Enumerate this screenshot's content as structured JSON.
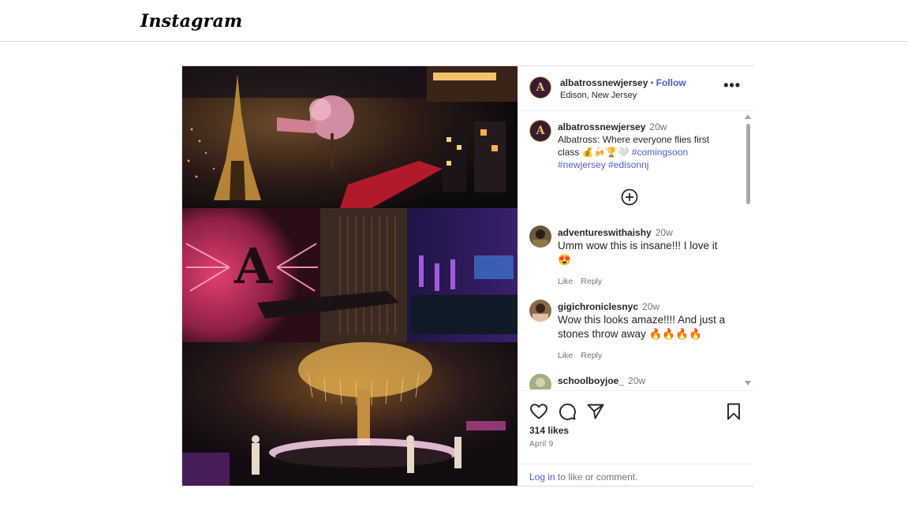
{
  "app": {
    "logo": "Instagram"
  },
  "post": {
    "author": "albatrossnewjersey",
    "follow_label": "Follow",
    "dot": "•",
    "location": "Edison, New Jersey",
    "avatar_letter": "A",
    "more_label": "•••",
    "caption": {
      "username": "albatrossnewjersey",
      "time": "20w",
      "text": "Albatross: Where everyone flies first class 💰🍻🏆🤍",
      "hashtags": [
        "#comingsoon",
        "#newjersey",
        "#edisonnj"
      ]
    },
    "comments": [
      {
        "username": "adventureswithaishy",
        "time": "20w",
        "text": "Umm wow this is insane!!! I love it 😍",
        "like": "Like",
        "reply": "Reply"
      },
      {
        "username": "gigichroniclesnyc",
        "time": "20w",
        "text": "Wow this looks amaze!!!! And just a stones throw away 🔥🔥🔥🔥",
        "like": "Like",
        "reply": "Reply"
      },
      {
        "username": "schoolboyjoe_",
        "time": "20w",
        "text": ""
      }
    ],
    "likes": "314 likes",
    "date": "April 9",
    "login_link": "Log in",
    "login_text": " to like or comment."
  },
  "colors": {
    "link": "#4f5bd5",
    "border": "#dbdbdb",
    "muted": "#737373"
  },
  "icons": [
    "heart-icon",
    "comment-icon",
    "share-icon",
    "bookmark-icon",
    "plus-circle-icon",
    "more-icon"
  ]
}
